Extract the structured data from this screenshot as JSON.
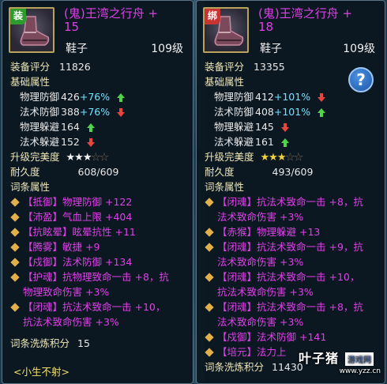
{
  "colors": {
    "title": "#e040e8",
    "label": "#f0e8b8",
    "percent": "#6fe3ff",
    "arrow_up": "#4fd44a",
    "arrow_down": "#e8453c",
    "affix": "#e040e8",
    "footer": "#f2e066"
  },
  "left": {
    "tag": "装",
    "title_line1": "(鬼)王湾之行舟 +",
    "title_line2": "15",
    "type": "鞋子",
    "level": "109级",
    "score_label": "装备评分",
    "score": "11826",
    "base_label": "基础属性",
    "stats": [
      {
        "name": "物理防御",
        "value": "426",
        "pct": "+76%",
        "arrow": "up"
      },
      {
        "name": "法术防御",
        "value": "388",
        "pct": "+76%",
        "arrow": "down"
      },
      {
        "name": "物理躲避",
        "value": "164",
        "pct": "",
        "arrow": "up"
      },
      {
        "name": "法术躲避",
        "value": "152",
        "pct": "",
        "arrow": "down"
      }
    ],
    "perfection_label": "升级完美度",
    "stars_on": 3,
    "stars_total": 5,
    "durability_label": "耐久度",
    "durability": "608/609",
    "affix_label": "词条属性",
    "affixes": [
      {
        "tag": "【抵御】",
        "text": "物理防御 +122",
        "cont": ""
      },
      {
        "tag": "【沛盈】",
        "text": "气血上限 +404",
        "cont": ""
      },
      {
        "tag": "【抗眩晕】",
        "text": "眩晕抗性 +11",
        "cont": ""
      },
      {
        "tag": "【腾雾】",
        "text": "敏捷 +9",
        "cont": ""
      },
      {
        "tag": "【戍御】",
        "text": "法术防御 +134",
        "cont": ""
      },
      {
        "tag": "【护魂】",
        "text": "抗物理致命一击 +8，抗",
        "cont": "物理致命伤害 +3%"
      },
      {
        "tag": "【闭魂】",
        "text": "抗法术致命一击 +10，",
        "cont": "抗法术致命伤害 +3%"
      }
    ],
    "refine_label": "词条洗炼积分",
    "refine": "15",
    "footer": "<小生不射>"
  },
  "right": {
    "tag": "绑",
    "title_line1": "(鬼)王湾之行舟 +",
    "title_line2": "18",
    "type": "鞋子",
    "level": "109级",
    "score_label": "装备评分",
    "score": "13355",
    "base_label": "基础属性",
    "stats": [
      {
        "name": "物理防御",
        "value": "412",
        "pct": "+101%",
        "arrow": "down"
      },
      {
        "name": "法术防御",
        "value": "408",
        "pct": "+101%",
        "arrow": "up"
      },
      {
        "name": "物理躲避",
        "value": "145",
        "pct": "",
        "arrow": "down"
      },
      {
        "name": "法术躲避",
        "value": "161",
        "pct": "",
        "arrow": "up"
      }
    ],
    "perfection_label": "升级完美度",
    "stars_on": 3,
    "stars_total": 5,
    "durability_label": "耐久度",
    "durability": "493/609",
    "affix_label": "词条属性",
    "affixes": [
      {
        "tag": "【闭魂】",
        "text": "抗法术致命一击 +8，抗",
        "cont": "法术致命伤害 +3%"
      },
      {
        "tag": "【赤猴】",
        "text": "物理躲避 +13",
        "cont": ""
      },
      {
        "tag": "【闭魂】",
        "text": "抗法术致命一击 +9，抗",
        "cont": "法术致命伤害 +3%"
      },
      {
        "tag": "【闭魂】",
        "text": "抗法术致命一击 +10，",
        "cont": "抗法术致命伤害 +3%"
      },
      {
        "tag": "【闭魂】",
        "text": "抗法术致命一击 +8，抗",
        "cont": "法术致命伤害 +3%"
      },
      {
        "tag": "【戍御】",
        "text": "法术防御 +141",
        "cont": ""
      },
      {
        "tag": "【培元】",
        "text": "法力上",
        "cont": ""
      }
    ],
    "refine_label": "词条洗炼积分",
    "refine": "11430",
    "help_icon": "question-icon"
  },
  "watermark": {
    "name": "叶子猪",
    "box": "游戏网",
    "url": "www.yzz.cn"
  }
}
